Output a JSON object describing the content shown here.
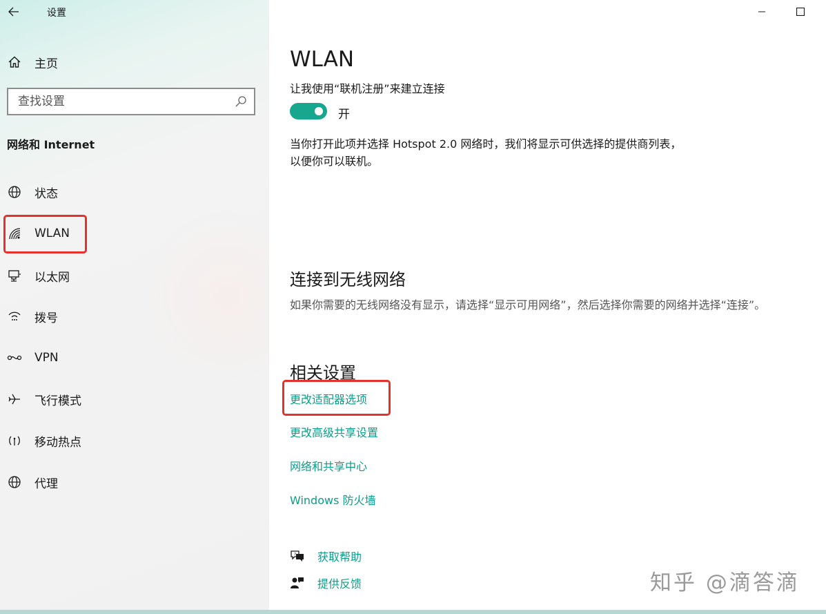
{
  "window": {
    "title": "设置",
    "minimize_icon": "minimize-icon",
    "maximize_icon": "maximize-icon"
  },
  "sidebar": {
    "home_label": "主页",
    "search_placeholder": "查找设置",
    "section_title": "网络和 Internet",
    "items": [
      {
        "label": "状态",
        "icon": "globe-icon"
      },
      {
        "label": "WLAN",
        "icon": "wifi-icon",
        "highlighted": true
      },
      {
        "label": "以太网",
        "icon": "ethernet-icon"
      },
      {
        "label": "拨号",
        "icon": "dialup-icon"
      },
      {
        "label": "VPN",
        "icon": "vpn-icon"
      },
      {
        "label": "飞行模式",
        "icon": "airplane-icon"
      },
      {
        "label": "移动热点",
        "icon": "hotspot-icon"
      },
      {
        "label": "代理",
        "icon": "proxy-globe-icon"
      }
    ]
  },
  "main": {
    "title": "WLAN",
    "hotspot": {
      "label": "让我使用“联机注册”来建立连接",
      "toggle_state": "开",
      "toggle_on": true,
      "description": "当你打开此项并选择 Hotspot 2.0 网络时，我们将显示可供选择的提供商列表，以便你可以联机。"
    },
    "connect": {
      "title": "连接到无线网络",
      "description": "如果你需要的无线网络没有显示，请选择“显示可用网络”，然后选择你需要的网络并选择“连接”。"
    },
    "related": {
      "title": "相关设置",
      "links": [
        "更改适配器选项",
        "更改高级共享设置",
        "网络和共享中心",
        "Windows 防火墙"
      ]
    },
    "help": {
      "get_help": "获取帮助",
      "feedback": "提供反馈"
    }
  },
  "watermark": "知乎 @滴答滴",
  "colors": {
    "accent": "#0c9d8a",
    "toggle_on": "#17a68e",
    "highlight": "#e5302b"
  }
}
